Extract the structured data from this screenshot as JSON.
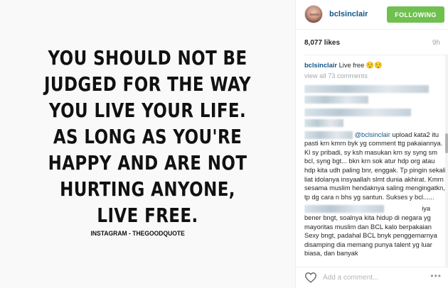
{
  "image": {
    "quote_lines": [
      "YOU SHOULD NOT BE",
      "JUDGED FOR THE WAY",
      "YOU LIVE YOUR LIFE.",
      "AS LONG AS YOU'RE",
      "HAPPY AND ARE NOT",
      "HURTING ANYONE,",
      "LIVE FREE."
    ],
    "credit": "INSTAGRAM - THEGOODQUOTE"
  },
  "header": {
    "username": "bclsinclair",
    "follow_label": "FOLLOWING"
  },
  "stats": {
    "likes": "8,077 likes",
    "age": "9h"
  },
  "caption": {
    "user": "bclsinclair",
    "text": "Live free 😌😌"
  },
  "view_all": "view all 73 comments",
  "comments": {
    "c1": {
      "mention": "@bclsinclair",
      "text": "upload kata2 itu pasti krn kmrn byk yg comment ttg pakaiannya. Kl sy pribadi, sy ksh masukan krn sy syng sm bcl, syng bgt... bkn krn sok atur hdp org atau hdp kita udh paling bnr, enggak. Tp pingin sekali liat idolanya insyaallah slmt dunia akhirat. Kmrn sesama muslim hendaknya saling mengingatkn, tp dg cara n bhs yg santun. Sukses y bcl......"
    },
    "c2": {
      "text": "iya bener bngt, soalnya kita hidup di negara yg mayoritas muslim dan BCL kalo berpakaian Sexy bngt, padahal BCL bnyk penggemarnya disamping dia memang punya talent yg luar biasa, dan banyak"
    }
  },
  "footer": {
    "comment_placeholder": "Add a comment...",
    "more": "•••"
  },
  "colors": {
    "follow_bg": "#70c050",
    "username": "#125688",
    "muted": "#a5a7aa"
  },
  "icons": {
    "like": "heart-outline-icon",
    "more": "more-options-icon"
  }
}
